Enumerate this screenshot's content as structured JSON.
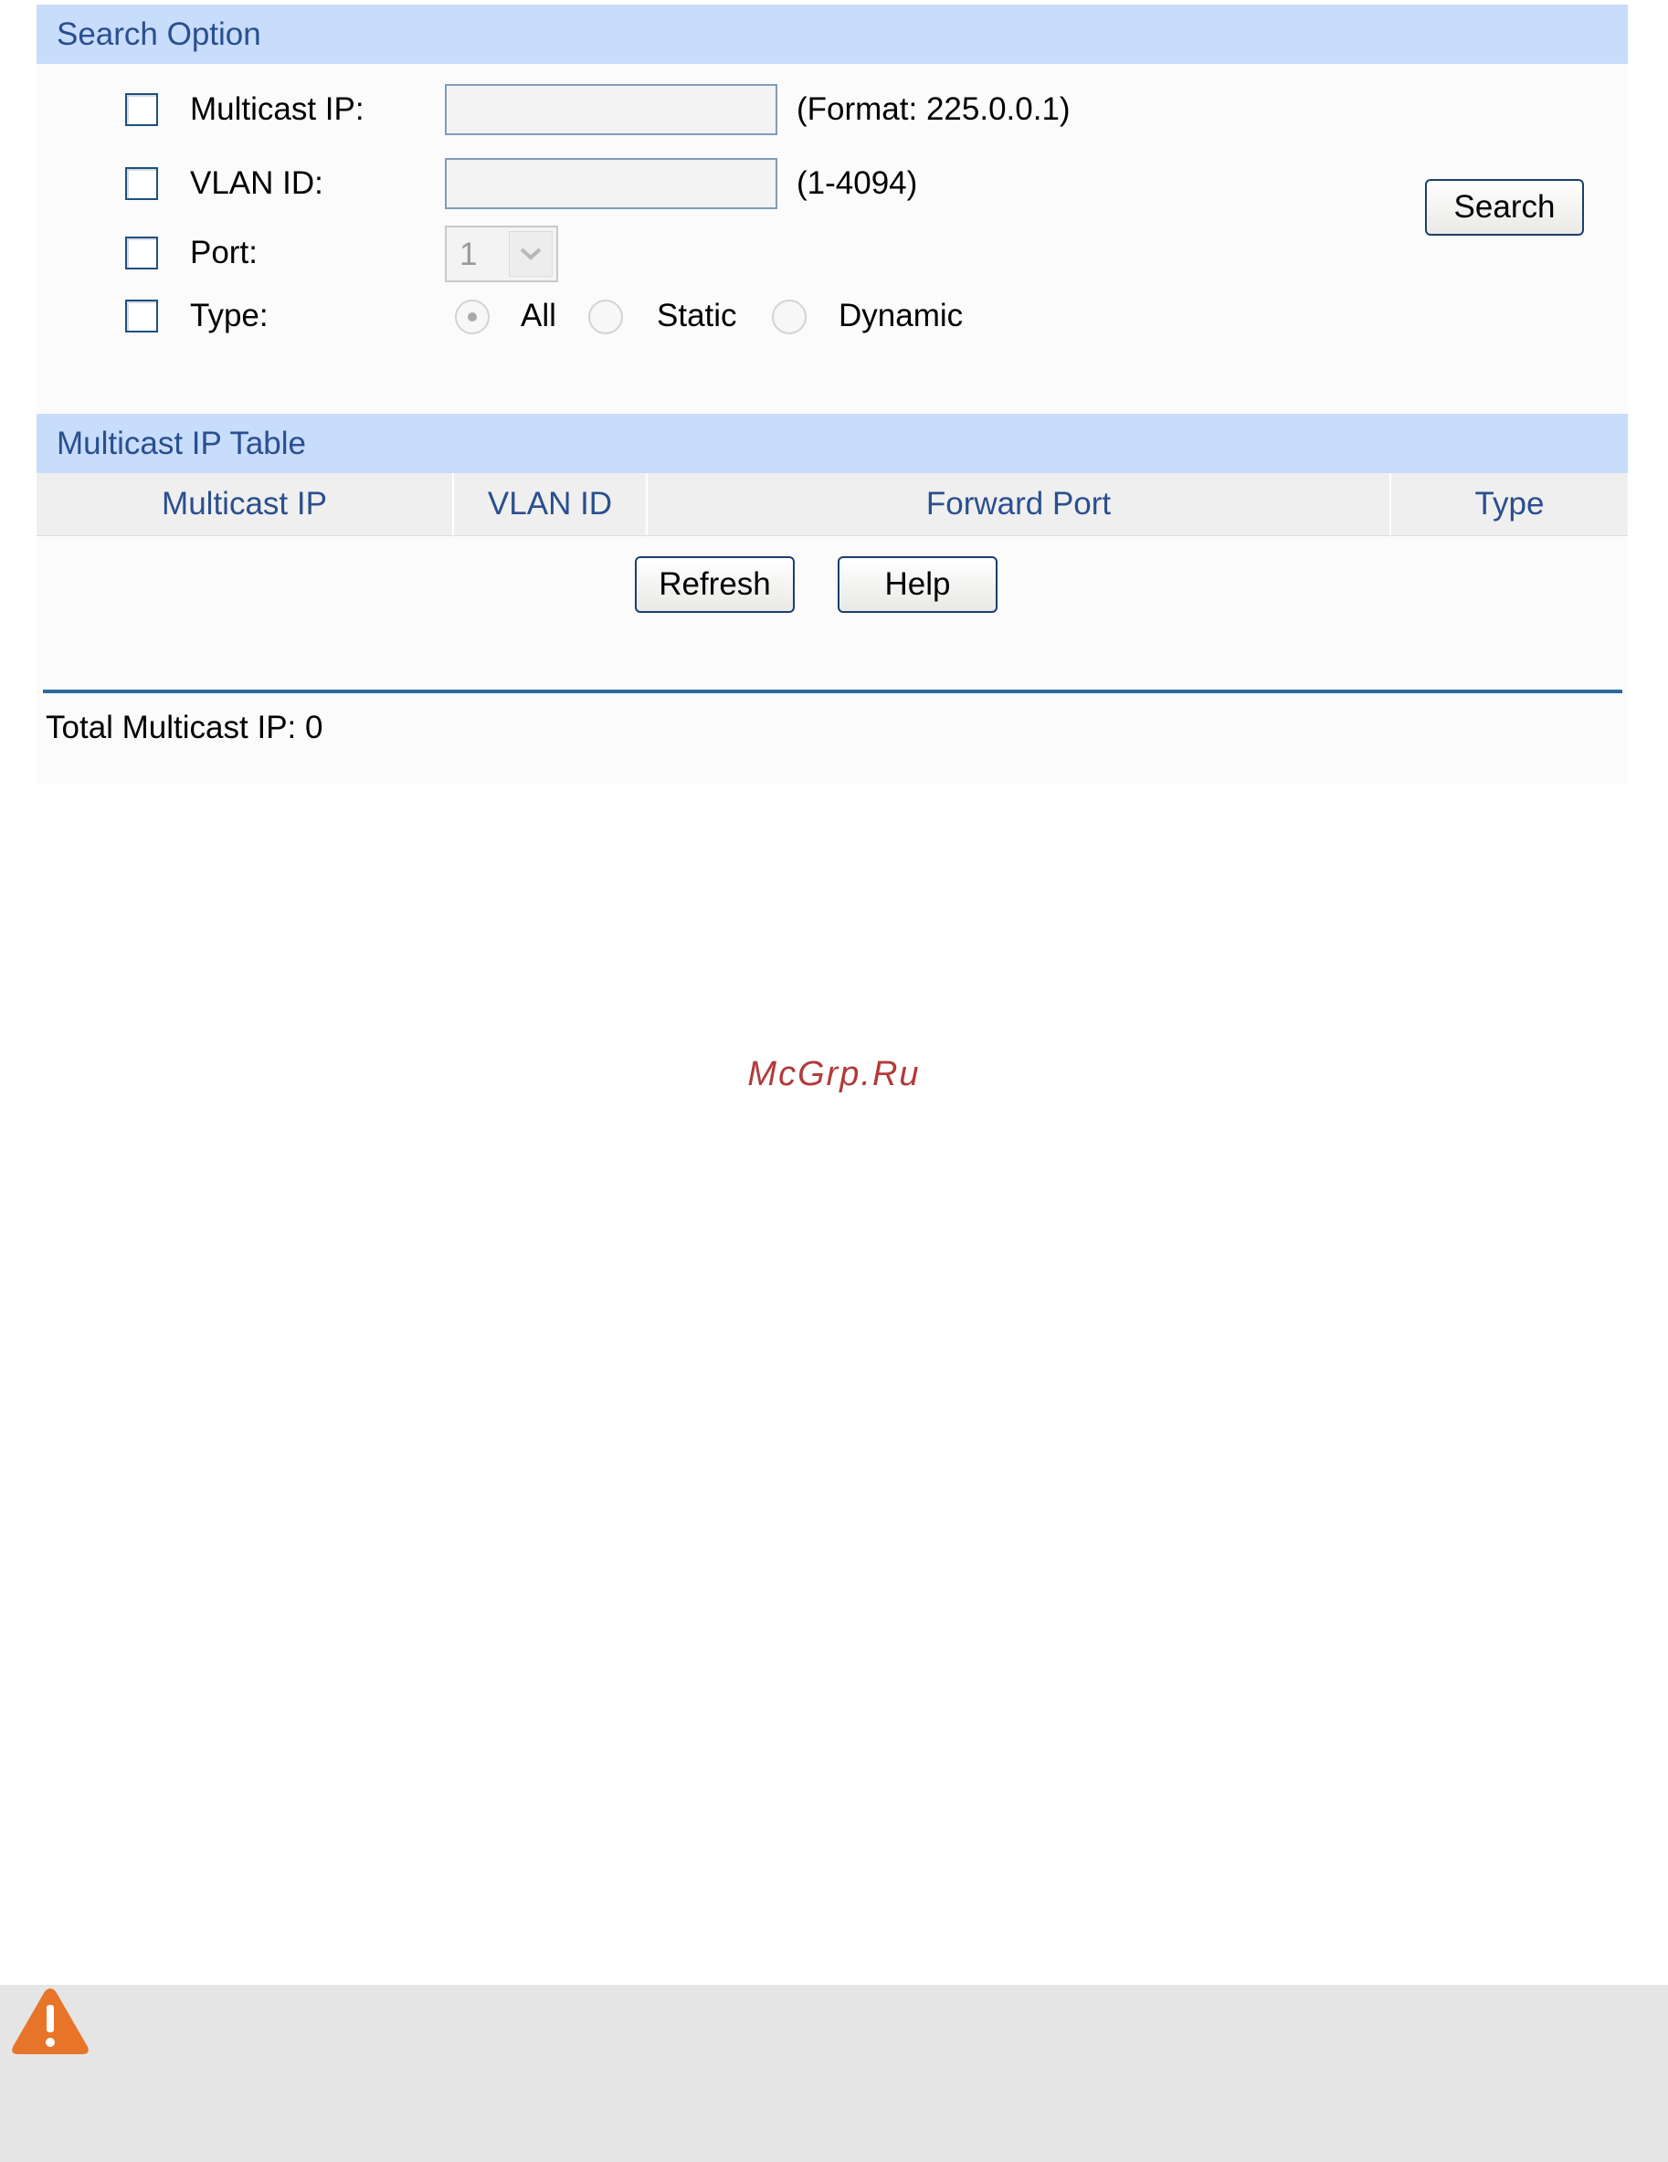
{
  "search_option": {
    "title": "Search Option",
    "multicast_ip": {
      "label": "Multicast IP:",
      "value": "",
      "hint": "(Format: 225.0.0.1)",
      "checked": false
    },
    "vlan_id": {
      "label": "VLAN ID:",
      "value": "",
      "hint": "(1-4094)",
      "checked": false
    },
    "port": {
      "label": "Port:",
      "selected": "1",
      "checked": false,
      "disabled": true
    },
    "type": {
      "label": "Type:",
      "checked": false,
      "options": [
        {
          "label": "All",
          "selected": true
        },
        {
          "label": "Static",
          "selected": false
        },
        {
          "label": "Dynamic",
          "selected": false
        }
      ]
    },
    "search_button": "Search"
  },
  "table": {
    "title": "Multicast IP Table",
    "columns": [
      "Multicast IP",
      "VLAN ID",
      "Forward Port",
      "Type"
    ],
    "rows": []
  },
  "buttons": {
    "refresh": "Refresh",
    "help": "Help"
  },
  "total": "Total Multicast IP: 0",
  "watermark": "McGrp.Ru",
  "colors": {
    "section_header_bg": "#c8dcfb",
    "header_text": "#2a4f8f",
    "divider": "#2e6a9c",
    "warning_icon": "#e8742a"
  },
  "icons": {
    "warning": "warning-triangle-icon",
    "dropdown": "chevron-down-icon"
  }
}
